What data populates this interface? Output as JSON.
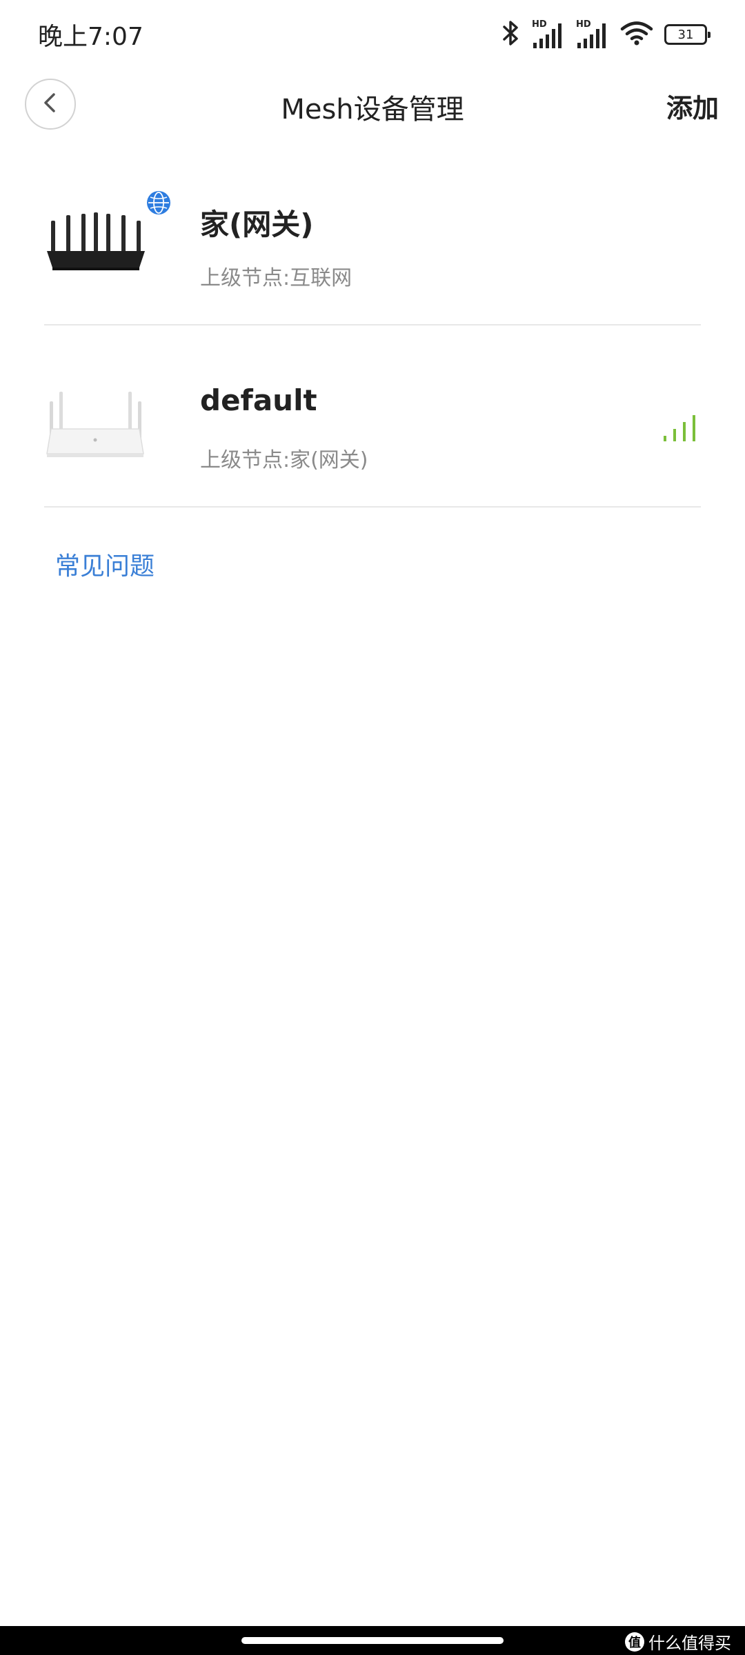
{
  "status_bar": {
    "time": "晚上7:07",
    "sim1_label": "HD",
    "sim2_label": "HD",
    "battery": "31"
  },
  "header": {
    "title": "Mesh设备管理",
    "add_label": "添加"
  },
  "devices": [
    {
      "name": "家(网关)",
      "parent": "上级节点:互联网",
      "icon": "router-black-icon",
      "badge": "globe-icon"
    },
    {
      "name": "default",
      "parent": "上级节点:家(网关)",
      "icon": "router-white-icon",
      "signal_level": 4,
      "signal_max": 4,
      "signal_color": "#7bbf3a"
    }
  ],
  "faq_label": "常见问题",
  "colors": {
    "accent": "#3a7fd6",
    "badge": "#2e7de0"
  },
  "watermark": {
    "logo": "值",
    "text": "什么值得买"
  }
}
